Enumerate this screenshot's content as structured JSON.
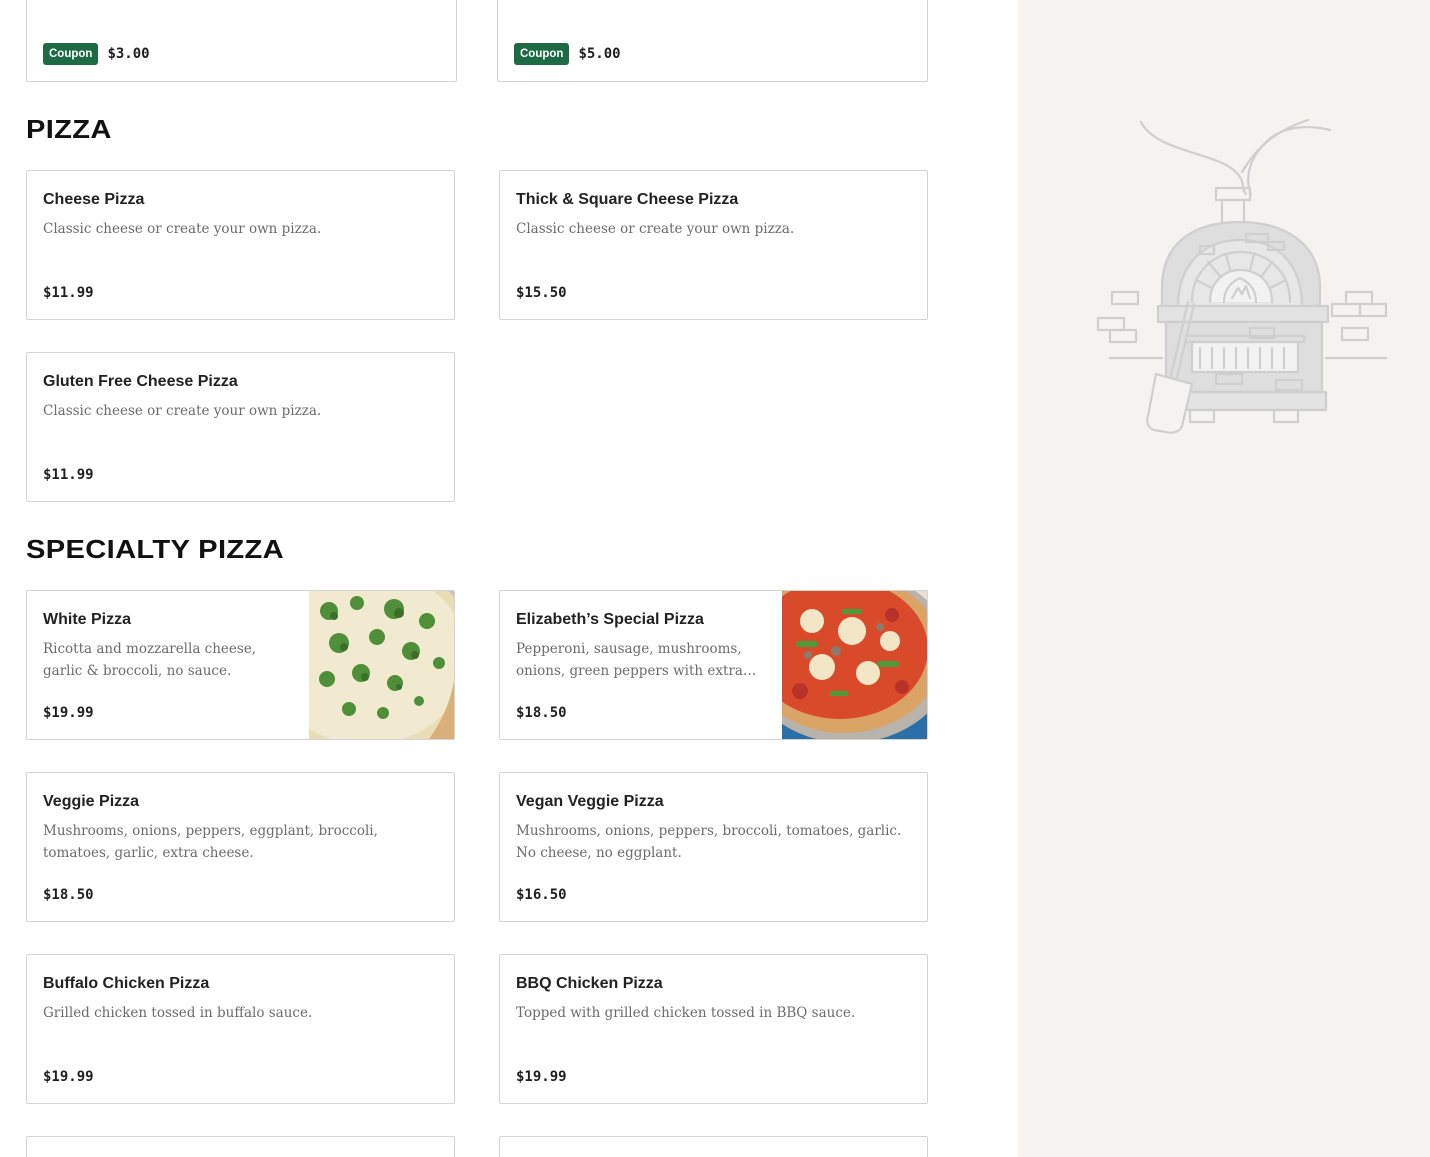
{
  "coupons": [
    {
      "badge": "Coupon",
      "price": "$3.00"
    },
    {
      "badge": "Coupon",
      "price": "$5.00"
    }
  ],
  "sections": {
    "pizza": {
      "title": "PIZZA",
      "items": [
        {
          "name": "Cheese Pizza",
          "desc": "Classic cheese or create your own pizza.",
          "price": "$11.99"
        },
        {
          "name": "Thick & Square Cheese Pizza",
          "desc": "Classic cheese or create your own pizza.",
          "price": "$15.50"
        },
        {
          "name": "Gluten Free Cheese Pizza",
          "desc": "Classic cheese or create your own pizza.",
          "price": "$11.99"
        }
      ]
    },
    "specialty": {
      "title": "SPECIALTY PIZZA",
      "items": [
        {
          "name": "White Pizza",
          "desc": "Ricotta and mozzarella cheese, garlic & broccoli, no sauce.",
          "price": "$19.99",
          "image": "white-pizza-photo"
        },
        {
          "name": "Elizabeth’s Special Pizza",
          "desc": "Pepperoni, sausage, mushrooms, onions, green peppers with extra…",
          "price": "$18.50",
          "image": "special-pizza-photo"
        },
        {
          "name": "Veggie Pizza",
          "desc": "Mushrooms, onions, peppers, eggplant, broccoli, tomatoes, garlic, extra cheese.",
          "price": "$18.50"
        },
        {
          "name": "Vegan Veggie Pizza",
          "desc": "Mushrooms, onions, peppers, broccoli, tomatoes, garlic. No cheese, no eggplant.",
          "price": "$16.50"
        },
        {
          "name": "Buffalo Chicken Pizza",
          "desc": "Grilled chicken tossed in buffalo sauce.",
          "price": "$19.99"
        },
        {
          "name": "BBQ Chicken Pizza",
          "desc": "Topped with grilled chicken tossed in BBQ sauce.",
          "price": "$19.99"
        }
      ]
    }
  },
  "illustration": {
    "icon": "pizza-oven-icon",
    "stroke_color": "#cfcfcf",
    "fill_color": "#dedede"
  },
  "colors": {
    "coupon": "#1d6b45",
    "sidebar": "#f4f3ef",
    "border": "#d4d4d4"
  }
}
